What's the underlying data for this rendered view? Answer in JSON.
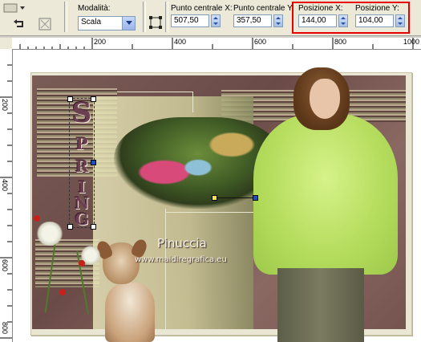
{
  "toolbar": {
    "mode_label": "Modalità:",
    "mode_value": "Scala",
    "center_x_label": "Punto centrale X:",
    "center_x_value": "507,50",
    "center_y_label": "Punto centrale Y:",
    "center_y_value": "357,50",
    "pos_x_label": "Posizione X:",
    "pos_x_value": "144,00",
    "pos_y_label": "Posizione Y:",
    "pos_y_value": "104,00",
    "highlight_color": "#e80000"
  },
  "ruler": {
    "h_labels": [
      "200",
      "400",
      "600",
      "800",
      "1000"
    ],
    "v_labels": [
      "200",
      "400",
      "600",
      "800"
    ]
  },
  "canvas": {
    "title_letters": [
      "S",
      "P",
      "R",
      "I",
      "N",
      "G"
    ],
    "watermark_name": "Pinuccia",
    "watermark_url": "www.maidiregrafica.eu"
  }
}
